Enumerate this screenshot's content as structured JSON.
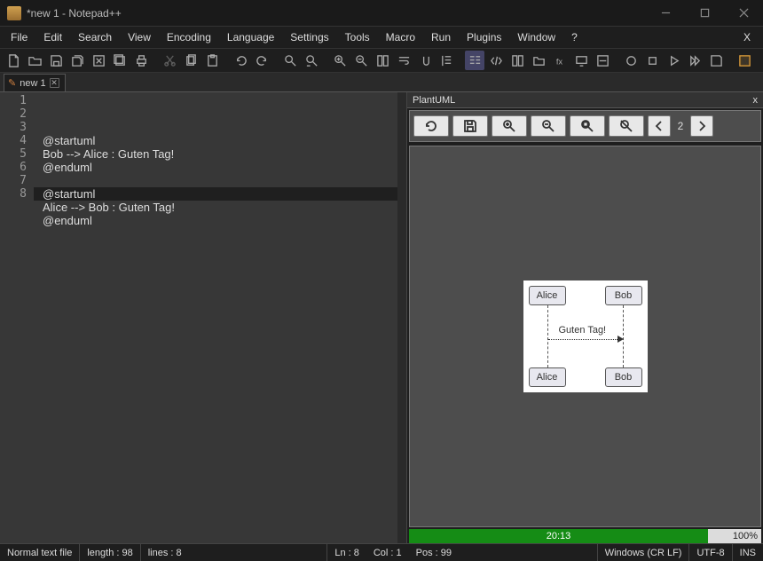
{
  "title": "*new 1 - Notepad++",
  "menus": [
    "File",
    "Edit",
    "Search",
    "View",
    "Encoding",
    "Language",
    "Settings",
    "Tools",
    "Macro",
    "Run",
    "Plugins",
    "Window",
    "?"
  ],
  "tab": {
    "name": "new 1"
  },
  "code": {
    "lines": [
      "@startuml",
      "Bob --> Alice : Guten Tag!",
      "@enduml",
      "",
      "@startuml",
      "Alice --> Bob : Guten Tag!",
      "@enduml",
      ""
    ],
    "current_line": 8
  },
  "plantuml": {
    "panel_title": "PlantUML",
    "page_index": "2",
    "diagram": {
      "actor_top_left": "Alice",
      "actor_top_right": "Bob",
      "actor_bottom_left": "Alice",
      "actor_bottom_right": "Bob",
      "message": "Guten Tag!"
    },
    "time": "20:13",
    "percent": "100%"
  },
  "status": {
    "filetype": "Normal text file",
    "length": "length : 98",
    "lines": "lines : 8",
    "ln": "Ln : 8",
    "col": "Col : 1",
    "pos": "Pos : 99",
    "eol": "Windows (CR LF)",
    "encoding": "UTF-8",
    "mode": "INS"
  }
}
